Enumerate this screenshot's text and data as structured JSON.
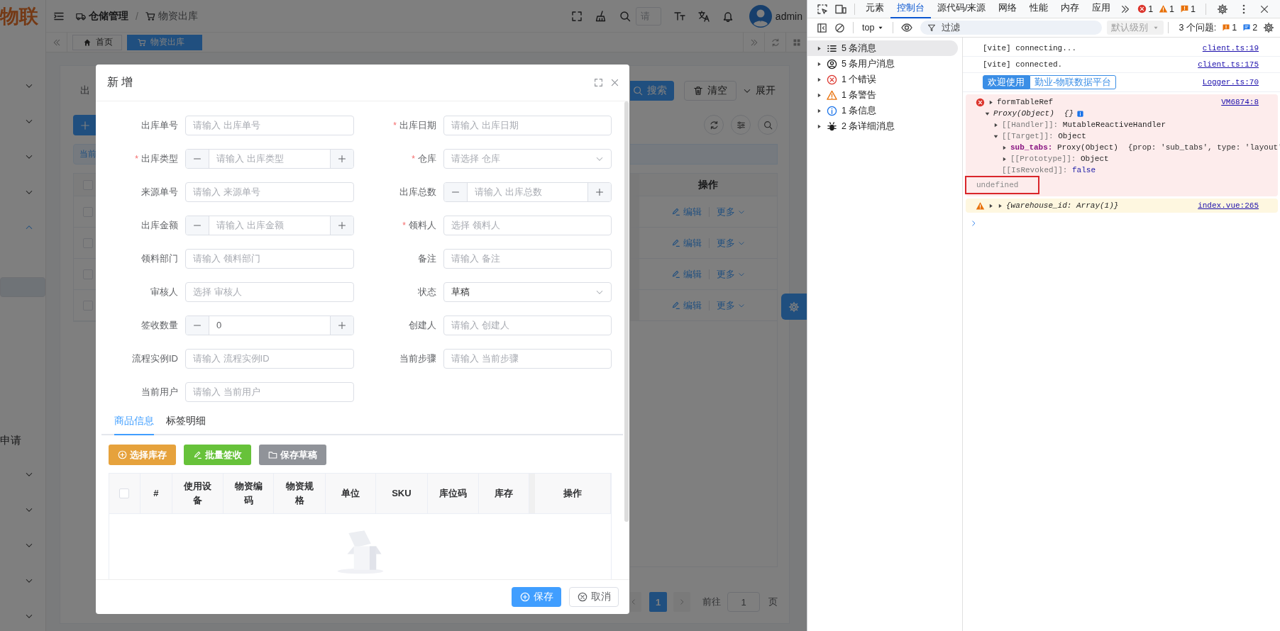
{
  "app": {
    "logo": "物联",
    "sidebar": {
      "items": [
        {
          "kind": "group",
          "expanded": false
        },
        {
          "kind": "group",
          "expanded": false
        },
        {
          "kind": "group",
          "expanded": false
        },
        {
          "kind": "group",
          "expanded": false
        },
        {
          "kind": "group",
          "expanded": true
        },
        {
          "kind": "child",
          "selected": false
        },
        {
          "kind": "child",
          "selected": true
        },
        {
          "kind": "child",
          "selected": false
        },
        {
          "kind": "child",
          "selected": false
        },
        {
          "kind": "child",
          "selected": false
        },
        {
          "kind": "child",
          "selected": false
        },
        {
          "kind": "child",
          "label": "申请",
          "selected": false
        },
        {
          "kind": "group",
          "expanded": false
        },
        {
          "kind": "group",
          "expanded": false
        },
        {
          "kind": "group",
          "expanded": false
        },
        {
          "kind": "group",
          "expanded": false
        },
        {
          "kind": "group",
          "expanded": false
        }
      ]
    },
    "breadcrumb": {
      "separator": "/",
      "items": [
        {
          "label": "仓储管理",
          "current": false
        },
        {
          "label": "物资出库",
          "current": true
        }
      ]
    },
    "header": {
      "search_placeholder": "请",
      "user": "admin"
    },
    "tags": [
      {
        "label": "首页",
        "selected": false
      },
      {
        "label": "物资出库",
        "selected": true
      }
    ],
    "page": {
      "search_label": "出",
      "search_buttons": [
        {
          "label": "搜索",
          "kind": "primary"
        },
        {
          "label": "清空",
          "kind": "default"
        }
      ],
      "expand_toggle": {
        "label": "展开",
        "expanded": false
      },
      "alert": "当前",
      "table": {
        "header_checked": false,
        "action_column": "操作",
        "rows": [
          {
            "checked": false,
            "actions": [
              "编辑",
              "更多"
            ]
          },
          {
            "checked": false,
            "actions": [
              "编辑",
              "更多"
            ]
          },
          {
            "checked": false,
            "actions": [
              "编辑",
              "更多"
            ]
          },
          {
            "checked": false,
            "actions": [
              "编辑",
              "更多"
            ]
          }
        ]
      },
      "pagination": {
        "pages": [
          {
            "label": "1",
            "selected": true
          }
        ],
        "goto_label": "前往",
        "goto_value": "1",
        "page_suffix": "页"
      }
    }
  },
  "dialog": {
    "title": "新 增",
    "fields": [
      {
        "label": "出库单号",
        "kind": "text",
        "placeholder": "请输入 出库单号"
      },
      {
        "label": "出库日期",
        "required_mark": "*",
        "kind": "text",
        "placeholder": "请输入 出库日期"
      },
      {
        "label": "出库类型",
        "required_mark": "*",
        "kind": "number",
        "placeholder": "请输入 出库类型"
      },
      {
        "label": "仓库",
        "required_mark": "*",
        "kind": "select",
        "placeholder": "请选择 仓库"
      },
      {
        "label": "来源单号",
        "kind": "text",
        "placeholder": "请输入 来源单号"
      },
      {
        "label": "出库总数",
        "kind": "number",
        "placeholder": "请输入 出库总数"
      },
      {
        "label": "出库金额",
        "kind": "number",
        "placeholder": "请输入 出库金额"
      },
      {
        "label": "领料人",
        "required_mark": "*",
        "kind": "text",
        "placeholder": "选择 领料人"
      },
      {
        "label": "领料部门",
        "kind": "text",
        "placeholder": "请输入 领料部门"
      },
      {
        "label": "备注",
        "kind": "text",
        "placeholder": "请输入 备注"
      },
      {
        "label": "审核人",
        "kind": "text",
        "placeholder": "选择 审核人"
      },
      {
        "label": "状态",
        "kind": "select",
        "value": "草稿"
      },
      {
        "label": "签收数量",
        "kind": "number",
        "value": "0"
      },
      {
        "label": "创建人",
        "kind": "text",
        "placeholder": "请输入 创建人"
      },
      {
        "label": "流程实例ID",
        "kind": "text",
        "placeholder": "请输入 流程实例ID"
      },
      {
        "label": "当前步骤",
        "kind": "text",
        "placeholder": "请输入 当前步骤"
      },
      {
        "label": "当前用户",
        "kind": "text",
        "placeholder": "请输入 当前用户"
      }
    ],
    "tabs": [
      {
        "label": "商品信息",
        "selected": true
      },
      {
        "label": "标签明细",
        "selected": false
      }
    ],
    "actions": [
      {
        "label": "选择库存",
        "kind": "warning"
      },
      {
        "label": "批量签收",
        "kind": "success"
      },
      {
        "label": "保存草稿",
        "kind": "info"
      }
    ],
    "table": {
      "select_all_checked": false,
      "columns": [
        "#",
        "使用设备",
        "物资编码",
        "物资规格",
        "单位",
        "SKU",
        "库位码",
        "库存",
        "操作"
      ]
    },
    "footer_buttons": [
      {
        "label": "保存",
        "kind": "primary"
      },
      {
        "label": "取消",
        "kind": "default"
      }
    ]
  },
  "devtools": {
    "panels": [
      {
        "label": "元素",
        "selected": false
      },
      {
        "label": "控制台",
        "selected": true
      },
      {
        "label": "源代码/来源",
        "selected": false
      },
      {
        "label": "网络",
        "selected": false
      },
      {
        "label": "性能",
        "selected": false
      },
      {
        "label": "内存",
        "selected": false
      },
      {
        "label": "应用",
        "selected": false
      }
    ],
    "counts": [
      {
        "kind": "error",
        "count": "1"
      },
      {
        "kind": "warning",
        "count": "1"
      },
      {
        "kind": "issue",
        "count": "1"
      }
    ],
    "context": "top",
    "filter_placeholder": "过滤",
    "levels": {
      "label": "默认级别",
      "disabled": true
    },
    "issues_label": "3 个问题:",
    "issue_counts": [
      {
        "kind": "issue",
        "count": "1"
      },
      {
        "kind": "info",
        "count": "2"
      }
    ],
    "sidebar": [
      {
        "kind": "messages",
        "label": "5 条消息",
        "selected": true
      },
      {
        "kind": "user",
        "label": "5 条用户消息",
        "selected": false
      },
      {
        "kind": "error",
        "label": "1 个错误",
        "selected": false
      },
      {
        "kind": "warning",
        "label": "1 条警告",
        "selected": false
      },
      {
        "kind": "info",
        "label": "1 条信息",
        "selected": false
      },
      {
        "kind": "verbose",
        "label": "2 条详细消息",
        "selected": false
      }
    ],
    "messages": [
      {
        "kind": "log",
        "text": "[vite] connecting...",
        "source": "client.ts:19"
      },
      {
        "kind": "log",
        "text": "[vite] connected.",
        "source": "client.ts:175"
      },
      {
        "kind": "styled",
        "parts": [
          "欢迎使用",
          "勤业-物联数据平台"
        ],
        "source": "Logger.ts:70"
      },
      {
        "kind": "error",
        "source": "VM6874:8",
        "values": [
          {
            "kind": "label",
            "text": "formTableRef",
            "expanded": false
          },
          {
            "kind": "object",
            "text": "Proxy(Object)",
            "preview": "{}",
            "expanded": true,
            "children": [
              {
                "kind": "internal",
                "key": "[[Handler]]:",
                "value": "MutableReactiveHandler",
                "expanded": false
              },
              {
                "kind": "internal",
                "key": "[[Target]]:",
                "value": "Object",
                "expanded": true,
                "children": [
                  {
                    "kind": "property",
                    "key": "sub_tabs:",
                    "value": "Proxy(Object)",
                    "preview": "{prop: 'sub_tabs', type: 'layout'",
                    "expanded": false
                  },
                  {
                    "kind": "internal",
                    "key": "[[Prototype]]:",
                    "value": "Object",
                    "expanded": false
                  }
                ]
              },
              {
                "kind": "flag",
                "key": "[[IsRevoked]]:",
                "value": "false"
              }
            ]
          }
        ],
        "result": {
          "text": "undefined",
          "highlighted": true
        }
      },
      {
        "kind": "warning",
        "expanded": false,
        "source": "index.vue:265",
        "values": [
          {
            "kind": "object",
            "text": "{warehouse_id: Array(1)}",
            "expanded": false
          }
        ]
      }
    ]
  }
}
